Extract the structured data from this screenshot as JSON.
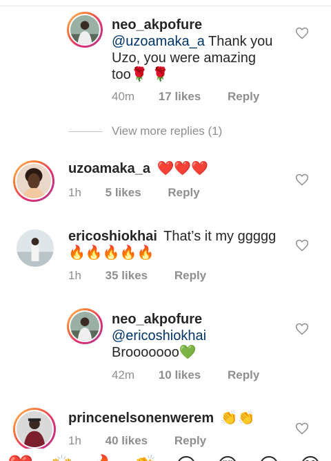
{
  "comments": [
    {
      "username": "neo_akpofure",
      "mention": "@uzoamaka_a",
      "text_lines": [
        "Thank you",
        "Uzo, you were amazing",
        "too🌹 🌹"
      ],
      "time": "40m",
      "likes": "17 likes",
      "reply": "Reply"
    },
    {
      "view_more": "View more replies (1)"
    },
    {
      "username": "uzoamaka_a",
      "text": "❤️❤️❤️",
      "time": "1h",
      "likes": "5 likes",
      "reply": "Reply"
    },
    {
      "username": "ericoshiokhai",
      "text": "That’s it my ggggg",
      "text2": "🔥🔥🔥🔥🔥",
      "time": "1h",
      "likes": "35 likes",
      "reply": "Reply"
    },
    {
      "username": "neo_akpofure",
      "mention": "@ericoshiokhai",
      "text2": "Brooooooo💚",
      "time": "42m",
      "likes": "10 likes",
      "reply": "Reply"
    },
    {
      "username": "princenelsonenwerem",
      "text": "👏👏",
      "time": "1h",
      "likes": "40 likes",
      "reply": "Reply"
    }
  ],
  "emoji_bar": [
    "❤️",
    "🙌",
    "🔥",
    "👏",
    "😢",
    "😍",
    "😮",
    "😂"
  ],
  "colors": {
    "mention": "#003569",
    "meta": "#8e8e8e",
    "text": "#262626"
  }
}
